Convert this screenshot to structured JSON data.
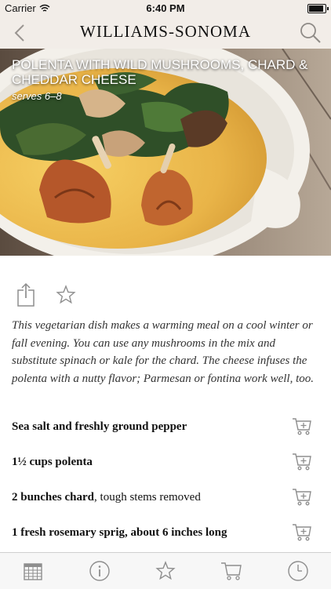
{
  "status": {
    "carrier": "Carrier",
    "time": "6:40 PM",
    "battery_level": 0.95
  },
  "nav": {
    "brand": "WILLIAMS-SONOMA",
    "back_icon": "chevron-left-icon",
    "search_icon": "search-icon"
  },
  "recipe": {
    "title": "POLENTA WITH WILD MUSHROOMS, CHARD & CHEDDAR CHEESE",
    "serves": "serves 6–8",
    "description": "This vegetarian dish makes a warming meal on a cool winter or fall evening. You can use any mushrooms in the mix and substitute spinach or kale for the chard. The cheese infuses the polenta with a nutty flavor; Parmesan or fontina work well, too."
  },
  "actions": {
    "share_icon": "share-icon",
    "favorite_icon": "star-icon"
  },
  "ingredients": [
    {
      "bold": "Sea salt and freshly ground pepper",
      "rest": ""
    },
    {
      "bold": "1½ cups polenta",
      "rest": ""
    },
    {
      "bold": "2 bunches chard",
      "rest": ", tough stems removed"
    },
    {
      "bold": "1 fresh rosemary sprig, about 6 inches long",
      "rest": ""
    }
  ],
  "tabs": [
    {
      "icon": "calendar-icon"
    },
    {
      "icon": "info-icon"
    },
    {
      "icon": "star-icon"
    },
    {
      "icon": "cart-icon"
    },
    {
      "icon": "clock-icon"
    }
  ],
  "colors": {
    "bar_bg": "#f2ede8",
    "icon_gray": "#8e8e8e"
  }
}
